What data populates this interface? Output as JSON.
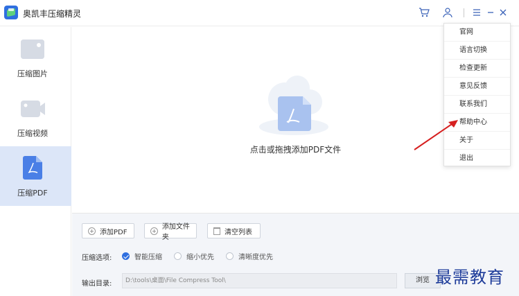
{
  "app": {
    "title": "奥凯丰压缩精灵"
  },
  "sidebar": {
    "items": [
      {
        "label": "压缩图片",
        "icon": "image-icon",
        "active": false
      },
      {
        "label": "压缩视频",
        "icon": "video-icon",
        "active": false
      },
      {
        "label": "压缩PDF",
        "icon": "pdf-icon",
        "active": true
      }
    ]
  },
  "titlebar": {
    "icons": [
      "cart-icon",
      "user-icon",
      "menu-icon",
      "minimize-icon",
      "close-icon"
    ]
  },
  "main": {
    "drop_label": "点击或拖拽添加PDF文件"
  },
  "toolbar": {
    "add_pdf_label": "添加PDF",
    "add_folder_label": "添加文件夹",
    "clear_list_label": "清空列表"
  },
  "options": {
    "label": "压缩选项:",
    "choices": [
      {
        "label": "智能压缩",
        "checked": true
      },
      {
        "label": "缩小优先",
        "checked": false
      },
      {
        "label": "清晰度优先",
        "checked": false
      }
    ]
  },
  "output": {
    "label": "输出目录:",
    "path": "D:\\tools\\桌面\\File Compress Tool\\",
    "browse_label": "浏览"
  },
  "menu": {
    "items": [
      "官网",
      "语言切换",
      "检查更新",
      "意见反馈",
      "联系我们",
      "帮助中心",
      "关于",
      "退出"
    ]
  },
  "watermark": "最需教育",
  "colors": {
    "accent": "#2f6fe0",
    "active_bg": "#dce6f8",
    "arrow": "#d62020"
  }
}
